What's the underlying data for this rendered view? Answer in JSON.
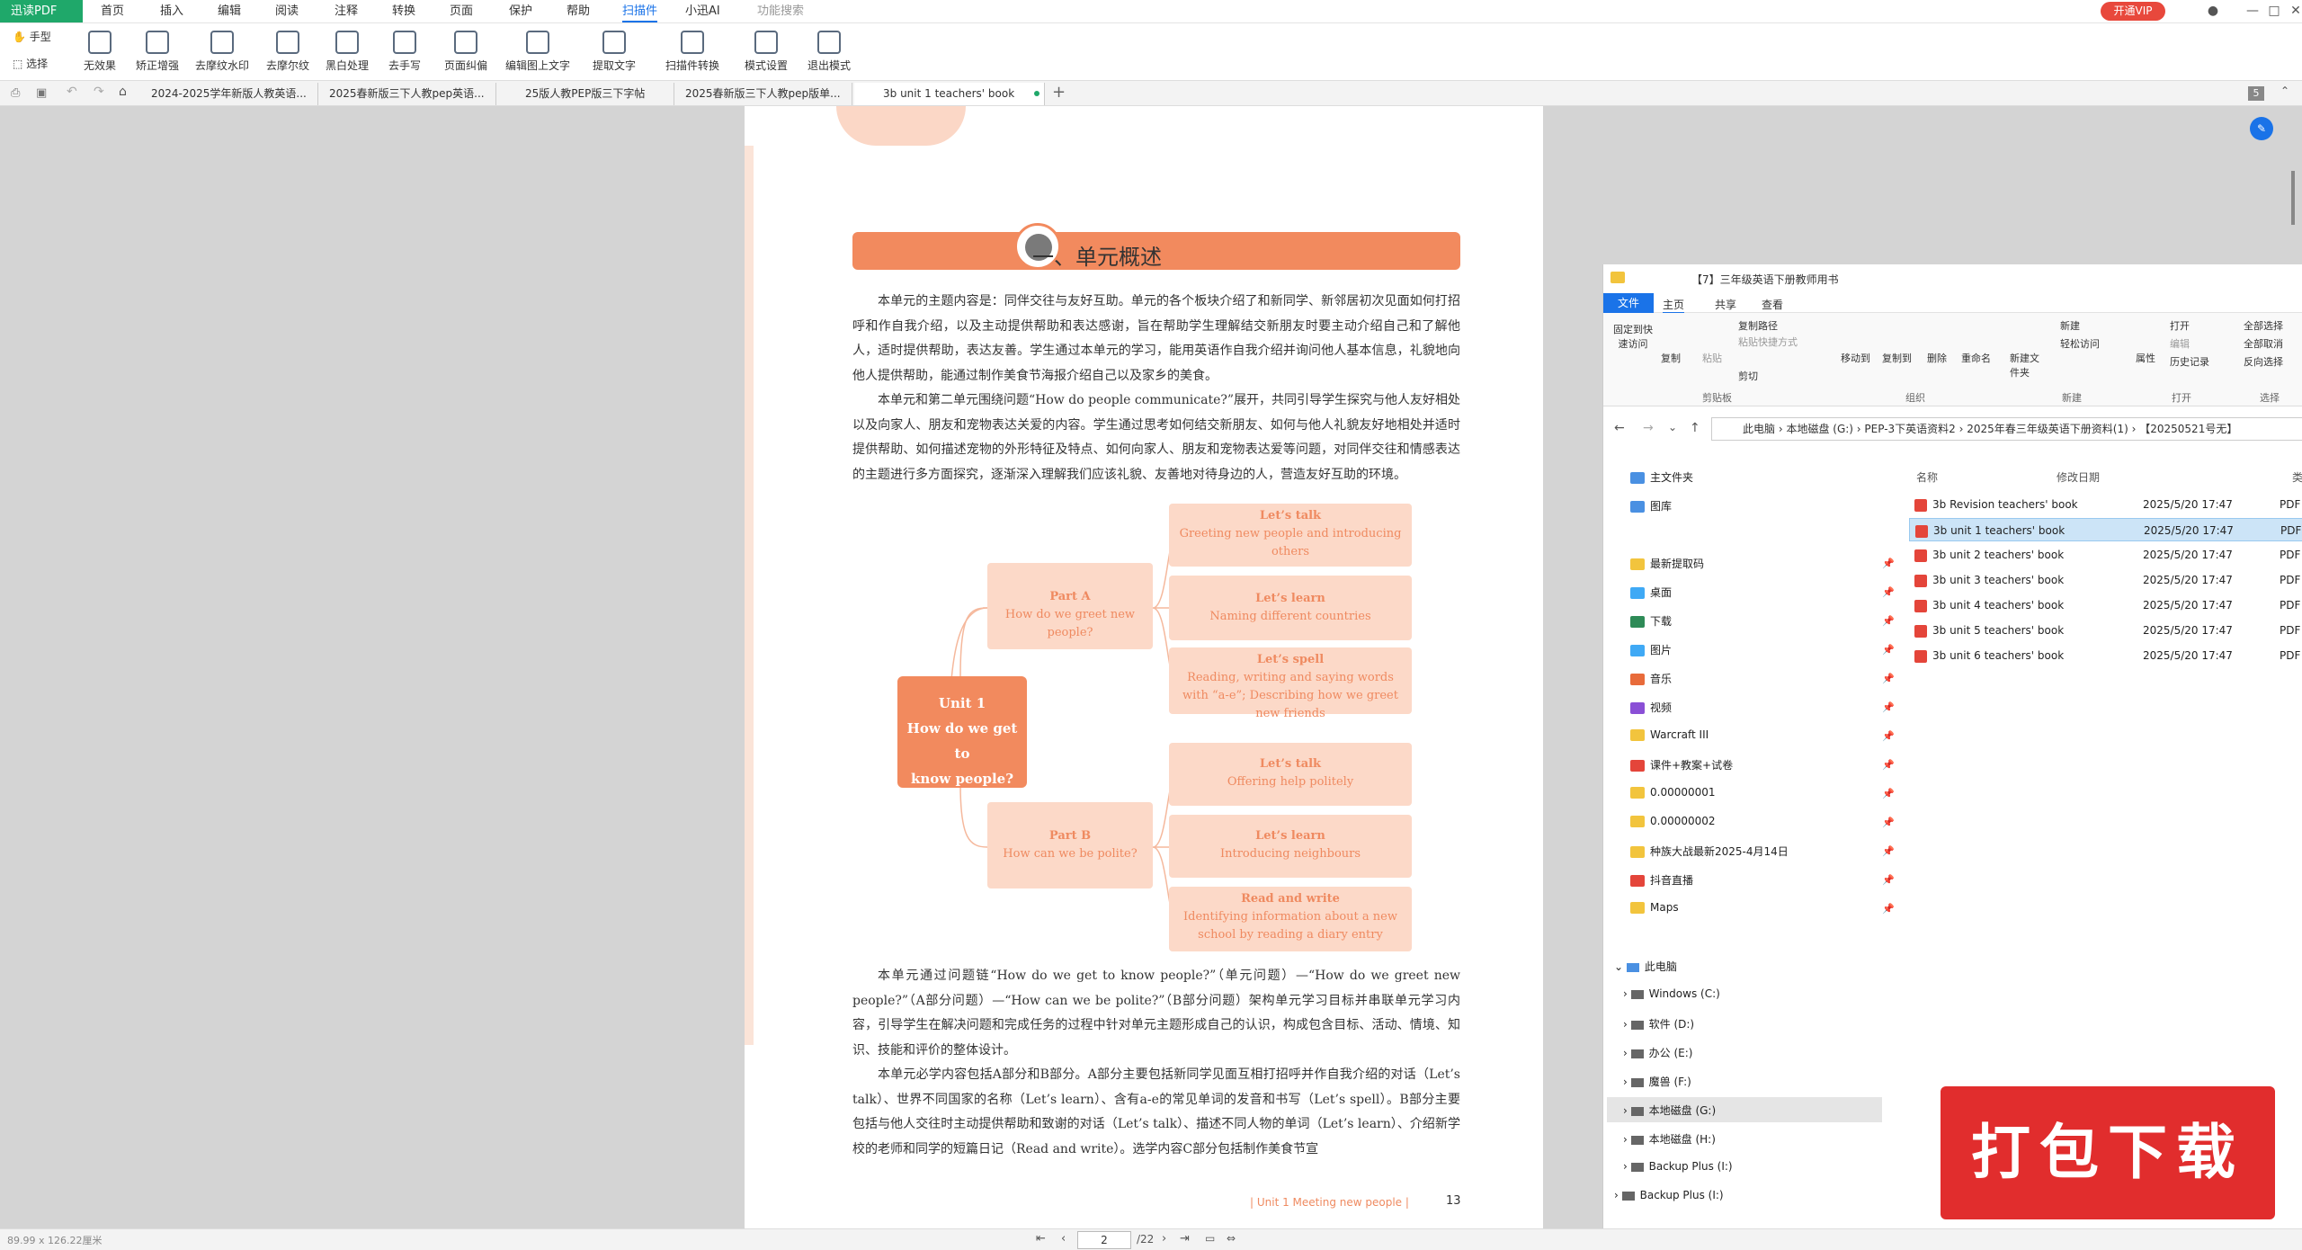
{
  "app": {
    "name": "迅读PDF"
  },
  "menu": [
    "首页",
    "插入",
    "编辑",
    "阅读",
    "注释",
    "转换",
    "页面",
    "保护",
    "帮助",
    "扫描件",
    "小迅AI",
    "功能搜索"
  ],
  "vip": "开通VIP",
  "ribbon_left": [
    "手型",
    "选择"
  ],
  "ribbon": [
    "无效果",
    "矫正增强",
    "去摩纹水印",
    "去摩尔纹",
    "黑白处理",
    "去手写",
    "页面纠偏",
    "编辑图上文字",
    "提取文字",
    "扫描件转换",
    "模式设置",
    "退出模式"
  ],
  "tabs": [
    "2024-2025学年新版人教英语...",
    "2025春新版三下人教pep英语...",
    "25版人教PEP版三下字帖",
    "2025春新版三下人教pep版单...",
    "3b unit 1 teachers' book"
  ],
  "tab_count": "5",
  "page": {
    "title": "一、单元概述",
    "p1": "本单元的主题内容是：同伴交往与友好互助。单元的各个板块介绍了和新同学、新邻居初次见面如何打招呼和作自我介绍，以及主动提供帮助和表达感谢，旨在帮助学生理解结交新朋友时要主动介绍自己和了解他人，适时提供帮助，表达友善。学生通过本单元的学习，能用英语作自我介绍并询问他人基本信息，礼貌地向他人提供帮助，能通过制作美食节海报介绍自己以及家乡的美食。",
    "p2": "本单元和第二单元围绕问题“How do people communicate?”展开，共同引导学生探究与他人友好相处以及向家人、朋友和宠物表达关爱的内容。学生通过思考如何结交新朋友、如何与他人礼貌友好地相处并适时提供帮助、如何描述宠物的外形特征及特点、如何向家人、朋友和宠物表达爱等问题，对同伴交往和情感表达的主题进行多方面探究，逐渐深入理解我们应该礼貌、友善地对待身边的人，营造友好互助的环境。",
    "p3": "本单元通过问题链“How do we get to know people?”（单元问题）—“How do we greet new people?”（A部分问题）—“How can we be polite?”（B部分问题）架构单元学习目标并串联单元学习内容，引导学生在解决问题和完成任务的过程中针对单元主题形成自己的认识，构成包含目标、活动、情境、知识、技能和评价的整体设计。",
    "p4": "本单元必学内容包括A部分和B部分。A部分主要包括新同学见面互相打招呼并作自我介绍的对话（Let’s talk）、世界不同国家的名称（Let’s learn）、含有a-e的常见单词的发音和书写（Let’s spell）。B部分主要包括与他人交往时主动提供帮助和致谢的对话（Let’s talk）、描述不同人物的单词（Let’s learn）、介绍新学校的老师和同学的短篇日记（Read and write）。选学内容C部分包括制作美食节宣",
    "footer": "|  Unit 1   Meeting new people  |",
    "page_num": "13",
    "map": {
      "center": [
        "Unit 1",
        "How do we get to",
        "know people?"
      ],
      "partA": [
        "Part A",
        "How do we greet new people?"
      ],
      "partB": [
        "Part B",
        "How can we be polite?"
      ],
      "a1": [
        "Let’s talk",
        "Greeting new people and introducing others"
      ],
      "a2": [
        "Let’s learn",
        "Naming different countries"
      ],
      "a3": [
        "Let’s spell",
        "Reading, writing and saying words with “a-e”; Describing how we greet new friends"
      ],
      "b1": [
        "Let’s talk",
        "Offering help politely"
      ],
      "b2": [
        "Let’s learn",
        "Introducing neighbours"
      ],
      "b3": [
        "Read and write",
        "Identifying information about a new school by reading a diary entry"
      ]
    }
  },
  "explorer": {
    "title": "【7】三年级英语下册教师用书",
    "tabs": [
      "文件",
      "主页",
      "共享",
      "查看"
    ],
    "groups": [
      "剪贴板",
      "组织",
      "新建",
      "打开",
      "选择"
    ],
    "cmds": [
      "固定到快速访问",
      "复制",
      "粘贴",
      "复制路径",
      "粘贴快捷方式",
      "剪切",
      "移动到",
      "复制到",
      "删除",
      "重命名",
      "新建文件夹",
      "新建",
      "轻松访问",
      "属性",
      "打开",
      "编辑",
      "历史记录",
      "全部选择",
      "全部取消",
      "反向选择"
    ],
    "path": [
      "此电脑",
      "本地磁盘 (G:)",
      "PEP-3下英语资料2",
      "2025年春三年级英语下册资料(1)",
      "【20250521号无】"
    ],
    "columns": [
      "名称",
      "修改日期",
      "类型"
    ],
    "files": [
      {
        "name": "3b Revision teachers' book",
        "date": "2025/5/20 17:47",
        "type": "PDF"
      },
      {
        "name": "3b unit 1 teachers' book",
        "date": "2025/5/20 17:47",
        "type": "PDF"
      },
      {
        "name": "3b unit 2 teachers' book",
        "date": "2025/5/20 17:47",
        "type": "PDF"
      },
      {
        "name": "3b unit 3 teachers' book",
        "date": "2025/5/20 17:47",
        "type": "PDF"
      },
      {
        "name": "3b unit 4 teachers' book",
        "date": "2025/5/20 17:47",
        "type": "PDF"
      },
      {
        "name": "3b unit 5 teachers' book",
        "date": "2025/5/20 17:47",
        "type": "PDF"
      },
      {
        "name": "3b unit 6 teachers' book",
        "date": "2025/5/20 17:47",
        "type": "PDF"
      }
    ],
    "nav_quick": [
      "主文件夹",
      "图库",
      "最新提取码",
      "桌面",
      "下载",
      "图片",
      "音乐",
      "视频",
      "Warcraft III",
      "课件+教案+试卷",
      "0.00000001",
      "0.00000002",
      "种族大战最新2025-4月14日",
      "抖音直播",
      "Maps"
    ],
    "nav_pc": [
      "此电脑",
      "Windows (C:)",
      "软件 (D:)",
      "办公 (E:)",
      "魔兽 (F:)",
      "本地磁盘 (G:)",
      "本地磁盘 (H:)",
      "Backup Plus (I:)",
      "Backup Plus (I:)"
    ]
  },
  "stamp": "打包下载",
  "status": {
    "size": "89.99 x 126.22厘米",
    "page": "2",
    "total": "/22"
  }
}
